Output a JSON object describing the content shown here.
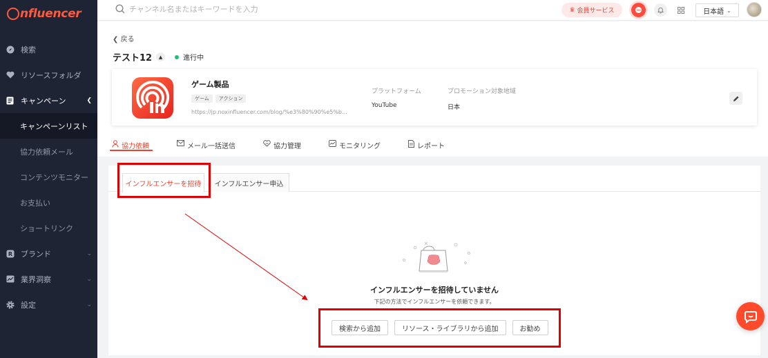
{
  "app": {
    "logo_text": "nfluencer"
  },
  "sidebar": {
    "items": [
      {
        "label": "検索",
        "icon": "compass-icon"
      },
      {
        "label": "リソースフォルダ",
        "icon": "heart-icon"
      },
      {
        "label": "キャンペーン",
        "icon": "document-icon",
        "expanded": true
      },
      {
        "label": "ブランド",
        "icon": "brand-icon"
      },
      {
        "label": "業界洞察",
        "icon": "chart-icon"
      },
      {
        "label": "設定",
        "icon": "gear-icon"
      }
    ],
    "sub_items": [
      {
        "label": "キャンペーンリスト",
        "active": true
      },
      {
        "label": "協力依頼メール"
      },
      {
        "label": "コンテンツモニター"
      },
      {
        "label": "お支払い"
      },
      {
        "label": "ショートリンク"
      }
    ]
  },
  "header": {
    "search_placeholder": "チャンネル名またはキーワードを入力",
    "member_label": "会員サービス",
    "language": "日本語"
  },
  "campaign": {
    "back_label": "戻る",
    "title": "テスト12",
    "status": "進行中",
    "status_color": "#1fbf76"
  },
  "product": {
    "name": "ゲーム製品",
    "tags": [
      "ゲーム",
      "アクション"
    ],
    "url": "https://jp.noxinfluencer.com/blog/%e3%80%90%e5%b...",
    "platform_label": "プラットフォーム",
    "platform_value": "YouTube",
    "region_label": "プロモーション対象地域",
    "region_value": "日本"
  },
  "tabs": [
    {
      "label": "協力依頼",
      "icon": "user-icon",
      "active": true
    },
    {
      "label": "メール一括送信",
      "icon": "mail-icon"
    },
    {
      "label": "協力管理",
      "icon": "handshake-icon"
    },
    {
      "label": "モニタリング",
      "icon": "monitor-icon"
    },
    {
      "label": "レポート",
      "icon": "report-icon"
    }
  ],
  "sub_tabs": [
    {
      "label": "インフルエンサーを招待",
      "active": true
    },
    {
      "label": "インフルエンサー申込"
    }
  ],
  "empty_state": {
    "title": "インフルエンサーを招待していません",
    "subtitle": "下記の方法でインフルエンサーを依頼できます。",
    "buttons": [
      "検索から追加",
      "リソース・ライブラリから追加",
      "お勧め"
    ]
  },
  "colors": {
    "accent": "#e8432f",
    "sidebar_bg": "#1e2434",
    "highlight": "#e00000"
  }
}
